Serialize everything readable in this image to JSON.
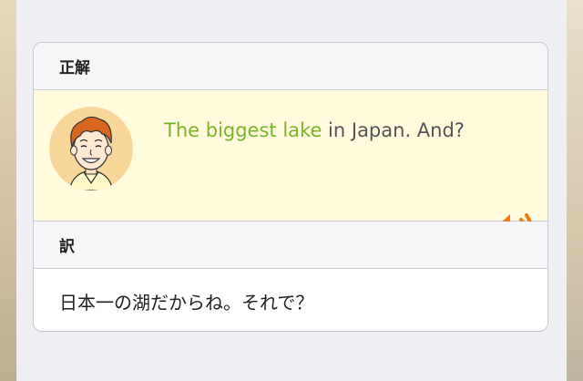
{
  "answer_section": {
    "heading": "正解",
    "sentence_highlight": "The biggest lake",
    "sentence_rest": " in Japan. And?",
    "highlight_color": "#7bb428"
  },
  "translation_section": {
    "heading": "訳",
    "text": "日本一の湖だからね。それで？"
  },
  "icons": {
    "avatar": "boy-character-avatar",
    "audio": "speaker-icon"
  },
  "colors": {
    "answer_background": "#fffbdc",
    "speaker": "#f07c13"
  }
}
